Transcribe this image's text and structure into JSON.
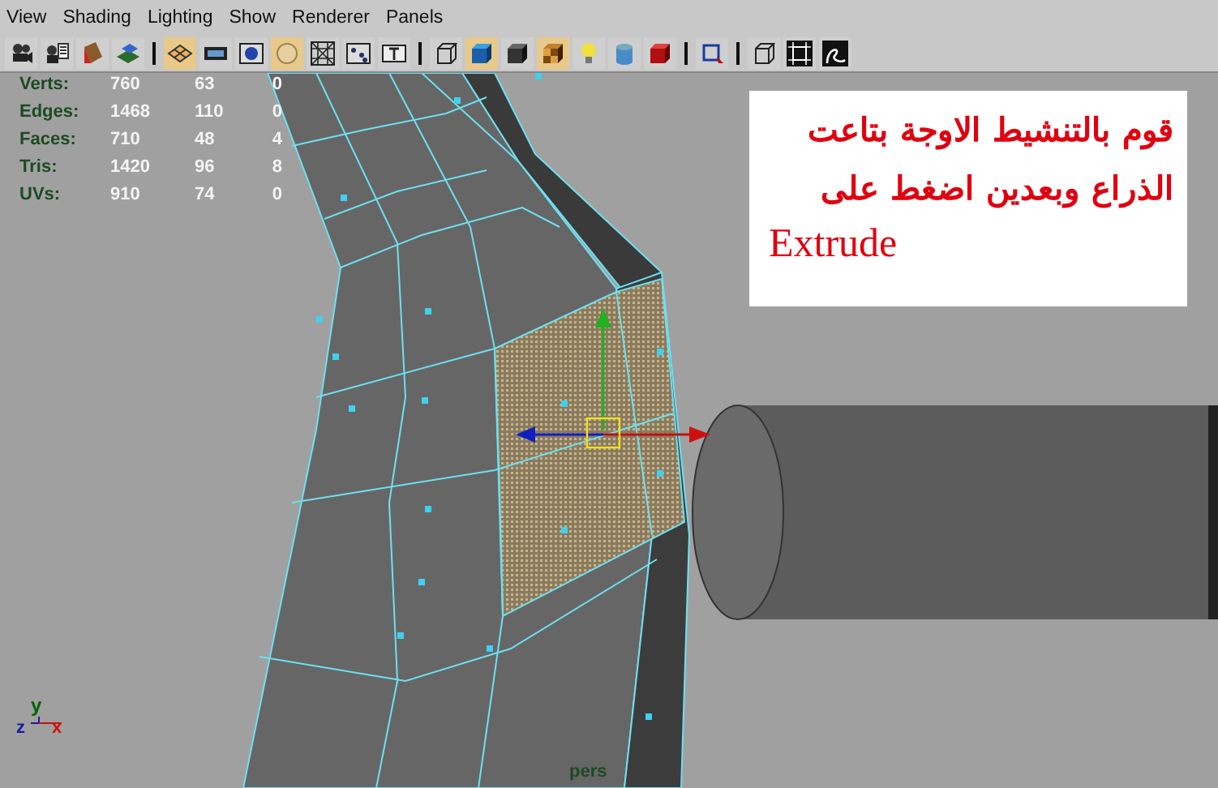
{
  "menu": [
    "View",
    "Shading",
    "Lighting",
    "Show",
    "Renderer",
    "Panels"
  ],
  "toolbar": [
    {
      "kind": "camera",
      "selected": false
    },
    {
      "kind": "camera-list",
      "selected": false
    },
    {
      "kind": "book",
      "selected": false
    },
    {
      "kind": "layers",
      "selected": false
    },
    {
      "kind": "separator"
    },
    {
      "kind": "grid-shade",
      "selected": true
    },
    {
      "kind": "film",
      "selected": false
    },
    {
      "kind": "sphere",
      "selected": false
    },
    {
      "kind": "disc",
      "selected": true
    },
    {
      "kind": "mesh",
      "selected": false
    },
    {
      "kind": "dots",
      "selected": false
    },
    {
      "kind": "text",
      "selected": false
    },
    {
      "kind": "separator"
    },
    {
      "kind": "wire-cube",
      "selected": false
    },
    {
      "kind": "blue-cube",
      "selected": true
    },
    {
      "kind": "dark-cube",
      "selected": false
    },
    {
      "kind": "checker-cube",
      "selected": true
    },
    {
      "kind": "bulb",
      "selected": false
    },
    {
      "kind": "cylinder",
      "selected": false
    },
    {
      "kind": "red-cube",
      "selected": false
    },
    {
      "kind": "separator"
    },
    {
      "kind": "select-rect",
      "selected": false
    },
    {
      "kind": "separator"
    },
    {
      "kind": "wire-cube",
      "selected": false
    },
    {
      "kind": "frame",
      "selected": false
    },
    {
      "kind": "curve",
      "selected": false
    }
  ],
  "stats": [
    {
      "label": "Verts:",
      "values": [
        "760",
        "63",
        "0"
      ]
    },
    {
      "label": "Edges:",
      "values": [
        "1468",
        "110",
        "0"
      ]
    },
    {
      "label": "Faces:",
      "values": [
        "710",
        "48",
        "4"
      ]
    },
    {
      "label": "Tris:",
      "values": [
        "1420",
        "96",
        "8"
      ]
    },
    {
      "label": "UVs:",
      "values": [
        "910",
        "74",
        "0"
      ]
    }
  ],
  "note": {
    "lines": [
      "قوم بالتنشيط الاوجة بتاعت",
      "الذراع وبعدين اضغط على"
    ],
    "command": "Extrude"
  },
  "axes": {
    "y": "y",
    "z": "z",
    "x": "x"
  },
  "camera_label": "pers"
}
